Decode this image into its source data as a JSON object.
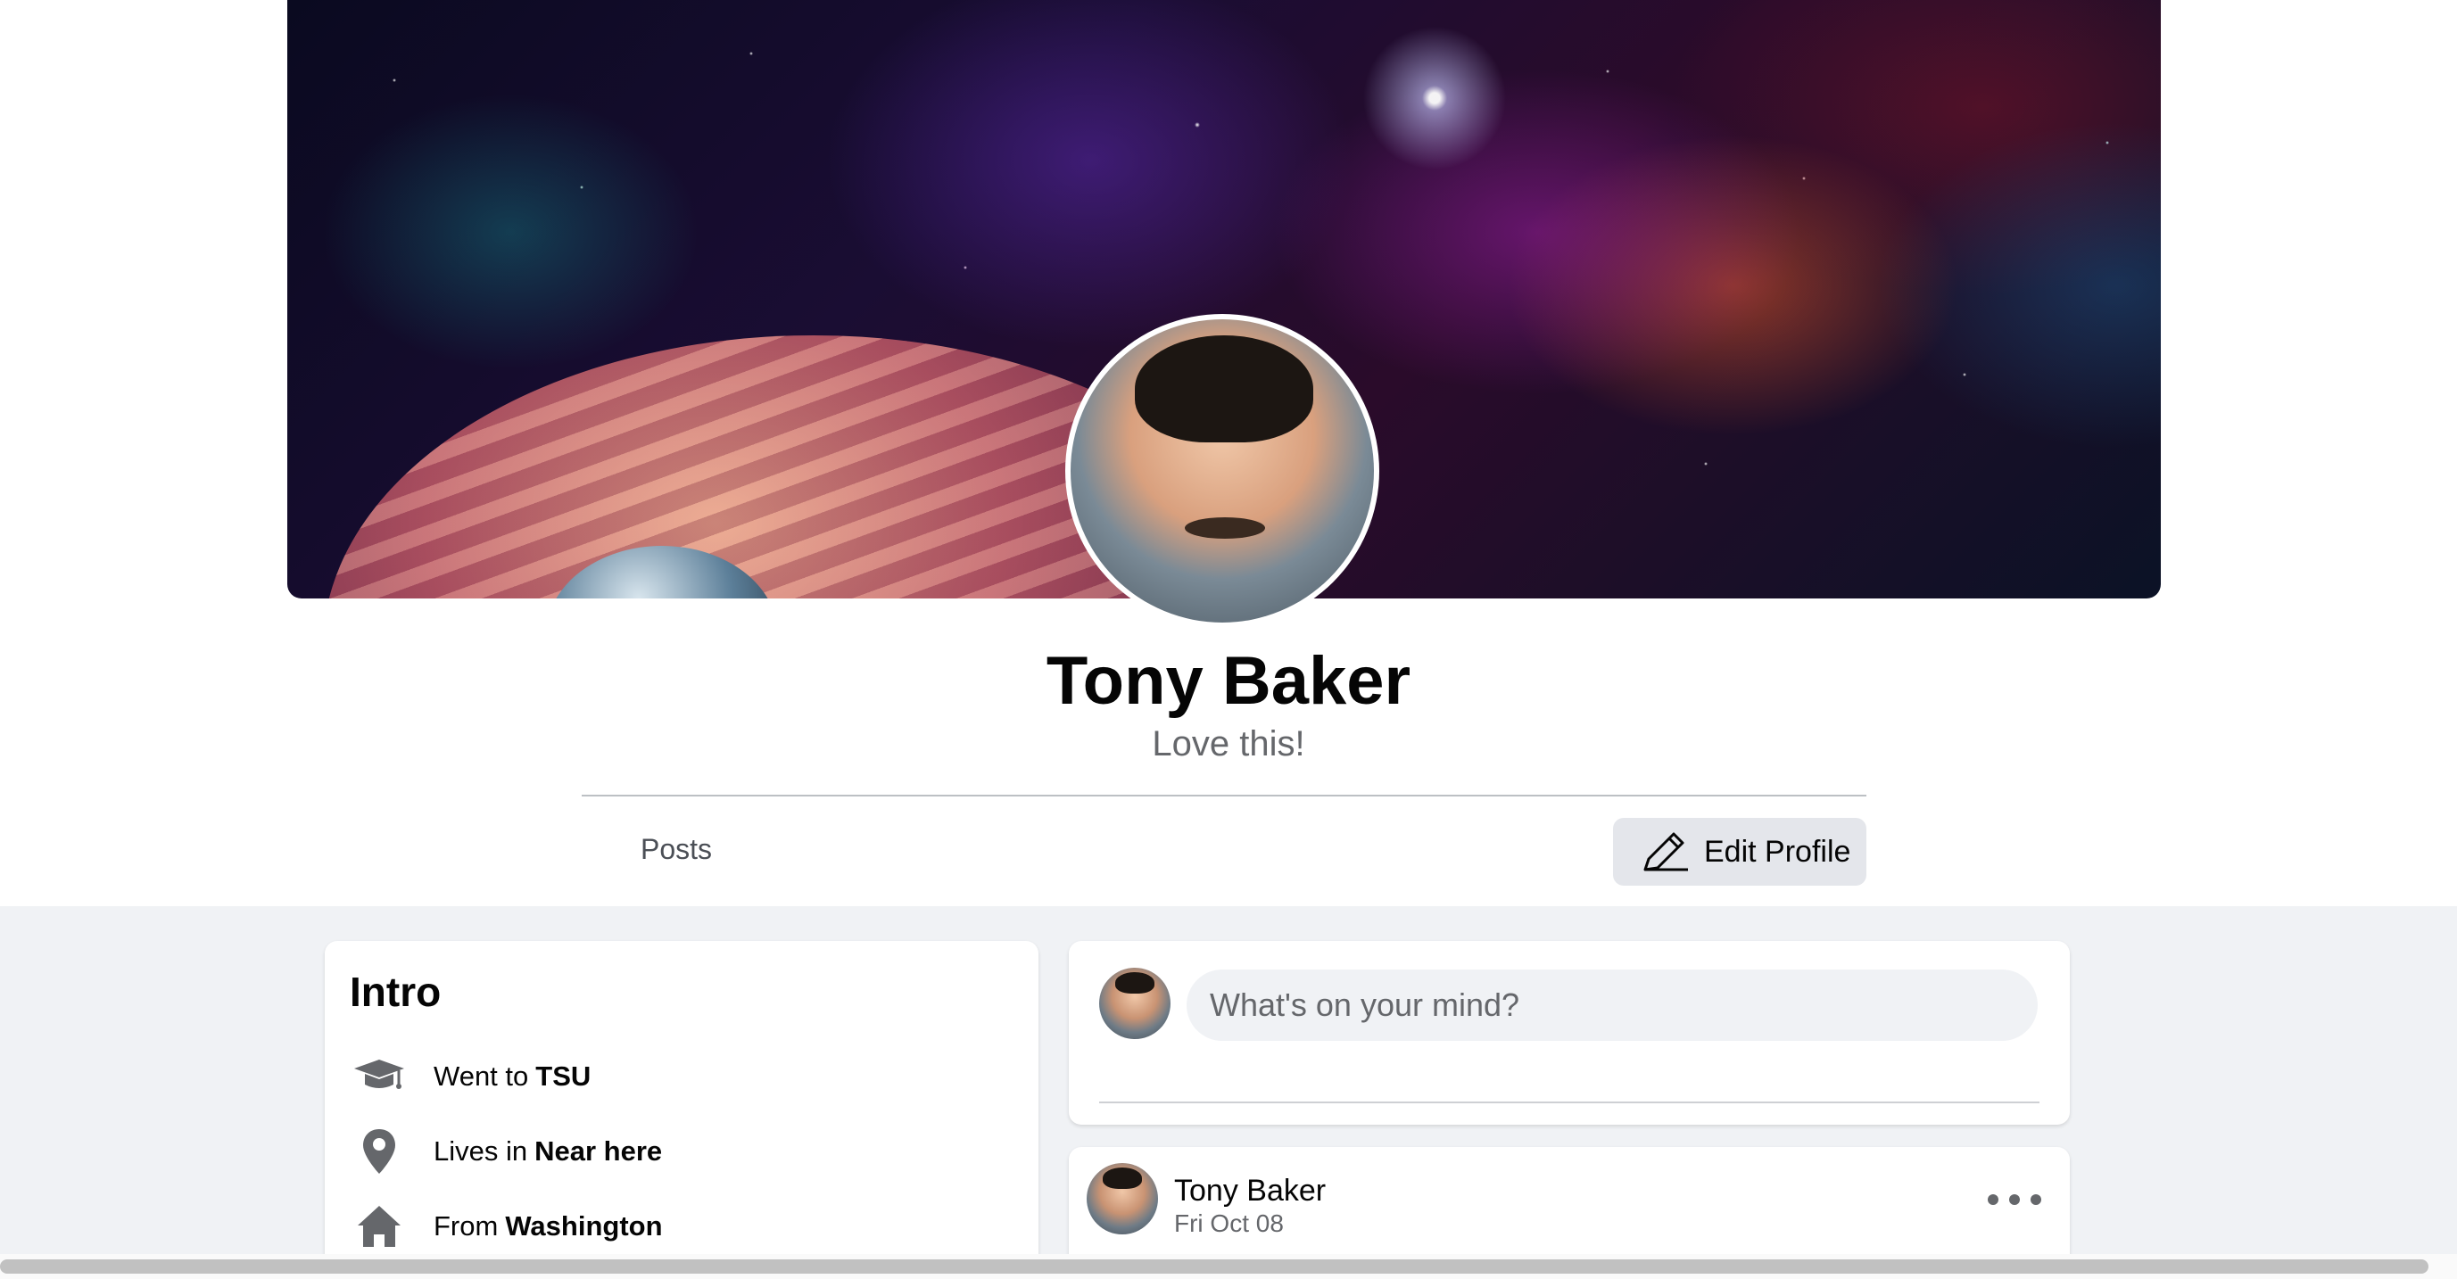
{
  "profile": {
    "name": "Tony Baker",
    "bio": "Love this!"
  },
  "tabs": {
    "posts_label": "Posts"
  },
  "edit_button": {
    "label": "Edit Profile",
    "icon": "pencil-icon"
  },
  "intro": {
    "title": "Intro",
    "rows": [
      {
        "icon": "graduation-cap-icon",
        "prefix": "Went to",
        "value": "TSU"
      },
      {
        "icon": "location-pin-icon",
        "prefix": "Lives in",
        "value": "Near here"
      },
      {
        "icon": "home-icon",
        "prefix": "From",
        "value": "Washington"
      }
    ]
  },
  "composer": {
    "placeholder": "What's on your mind?"
  },
  "post": {
    "author": "Tony Baker",
    "date": "Fri Oct 08",
    "more_icon": "more-options-icon"
  },
  "colors": {
    "page_bg": "#f0f2f5",
    "button_bg": "#e4e6eb",
    "secondary_text": "#65676b"
  }
}
